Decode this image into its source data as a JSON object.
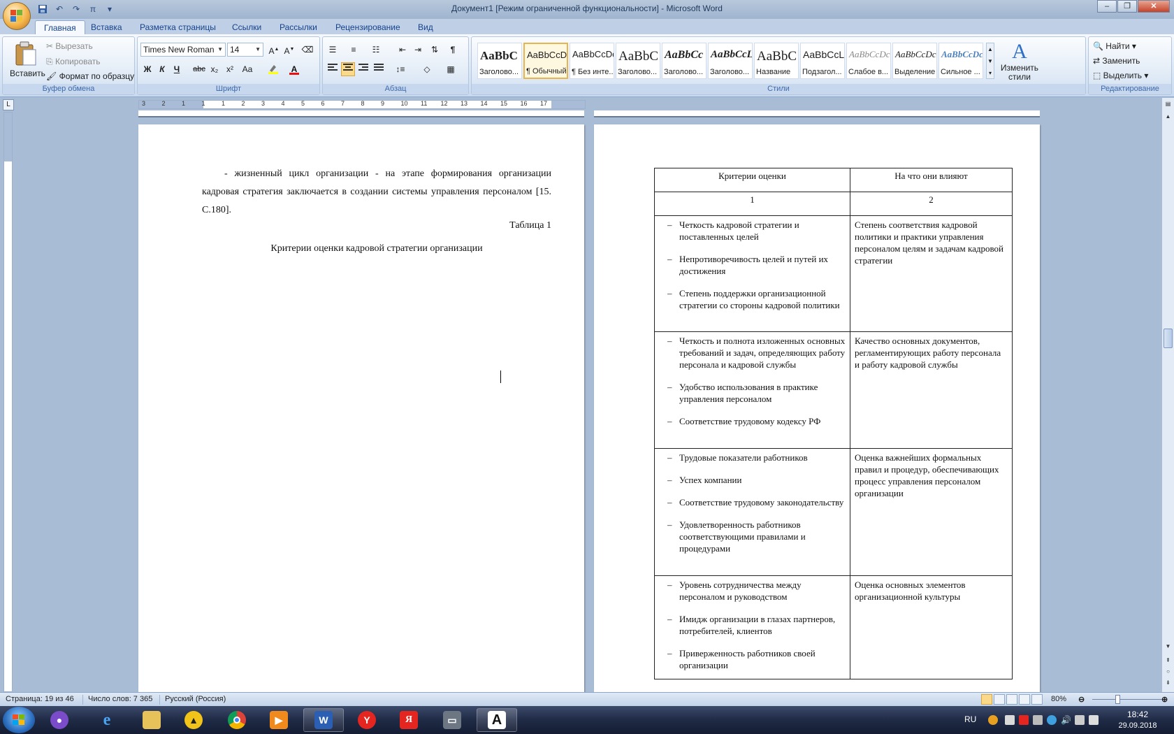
{
  "window": {
    "title": "Документ1 [Режим ограниченной функциональности] - Microsoft Word"
  },
  "tabs": [
    "Главная",
    "Вставка",
    "Разметка страницы",
    "Ссылки",
    "Рассылки",
    "Рецензирование",
    "Вид"
  ],
  "clipboard": {
    "paste": "Вставить",
    "cut": "Вырезать",
    "copy": "Копировать",
    "format_painter": "Формат по образцу",
    "label": "Буфер обмена"
  },
  "font": {
    "name": "Times New Roman",
    "size": "14",
    "label": "Шрифт",
    "bold": "Ж",
    "italic": "К",
    "underline": "Ч",
    "strike": "abc",
    "subscript": "x₂",
    "superscript": "x²",
    "change_case": "Aa"
  },
  "paragraph": {
    "label": "Абзац"
  },
  "styles": {
    "label": "Стили",
    "items": [
      {
        "sample": "AaBbC",
        "label": "Заголово..."
      },
      {
        "sample": "AaBbCcDc",
        "label": "¶ Обычный"
      },
      {
        "sample": "AaBbCcDc",
        "label": "¶ Без инте..."
      },
      {
        "sample": "AaBbC",
        "label": "Заголово..."
      },
      {
        "sample": "AaBbCc",
        "label": "Заголово..."
      },
      {
        "sample": "AaBbCcL",
        "label": "Заголово..."
      },
      {
        "sample": "AaBbC",
        "label": "Название"
      },
      {
        "sample": "AaBbCcL",
        "label": "Подзагол..."
      },
      {
        "sample": "AaBbCcDc",
        "label": "Слабое в..."
      },
      {
        "sample": "AaBbCcDc",
        "label": "Выделение"
      },
      {
        "sample": "AaBbCcDc",
        "label": "Сильное ..."
      }
    ],
    "change_styles": "Изменить стили"
  },
  "editing": {
    "label": "Редактирование",
    "find": "Найти",
    "replace": "Заменить",
    "select": "Выделить"
  },
  "ruler_numbers": [
    "3",
    "2",
    "1",
    "1",
    "1",
    "2",
    "3",
    "4",
    "5",
    "6",
    "7",
    "8",
    "9",
    "10",
    "11",
    "12",
    "13",
    "14",
    "15",
    "16",
    "17"
  ],
  "page1": {
    "paragraph": "- жизненный цикл организации - на этапе формирования организации кадровая стратегия заключается в создании системы управления персоналом [15. С.180].",
    "table_number": "Таблица 1",
    "table_title": "Критерии оценки кадровой стратегии организации"
  },
  "table": {
    "headers": [
      "Критерии оценки",
      "На что они влияют"
    ],
    "numbers": [
      "1",
      "2"
    ],
    "rows": [
      {
        "criteria": [
          "Четкость кадровой стратегии и поставленных целей",
          "Непротиворечивость целей и путей их достижения",
          "Степень поддержки организационной стратегии со стороны кадровой политики"
        ],
        "effect": "Степень соответствия кадровой политики и практики управления персоналом целям и задачам кадровой стратегии"
      },
      {
        "criteria": [
          "Четкость и полнота изложенных основных требований и задач, определяющих работу персонала и кадровой службы",
          "Удобство использования в практике управления персоналом",
          "Соответствие трудовому кодексу РФ"
        ],
        "effect": "Качество основных документов, регламентирующих работу персонала и работу кадровой службы"
      },
      {
        "criteria": [
          "Трудовые показатели работников",
          "Успех компании",
          "Соответствие трудовому законодательству",
          "Удовлетворенность работников соответствующими правилами и процедурами"
        ],
        "effect": "Оценка важнейших формальных правил и процедур, обеспечивающих процесс управления персоналом организации"
      },
      {
        "criteria": [
          "Уровень сотрудничества между персоналом и руководством",
          "Имидж организации в глазах партнеров, потребителей, клиентов",
          "Приверженность работников своей организации"
        ],
        "effect": "Оценка основных элементов организационной культуры"
      }
    ]
  },
  "status": {
    "page": "Страница: 19 из 46",
    "words": "Число слов: 7 365",
    "language": "Русский (Россия)",
    "zoom": "80%"
  },
  "taskbar": {
    "lang": "RU",
    "time": "18:42",
    "date": "29.09.2018"
  },
  "colors": {
    "titlebar_accent": "#9fb4cf",
    "ribbon": "#dae6f4",
    "workspace": "#a9bcd6",
    "selected_style": "#fbd98b"
  }
}
